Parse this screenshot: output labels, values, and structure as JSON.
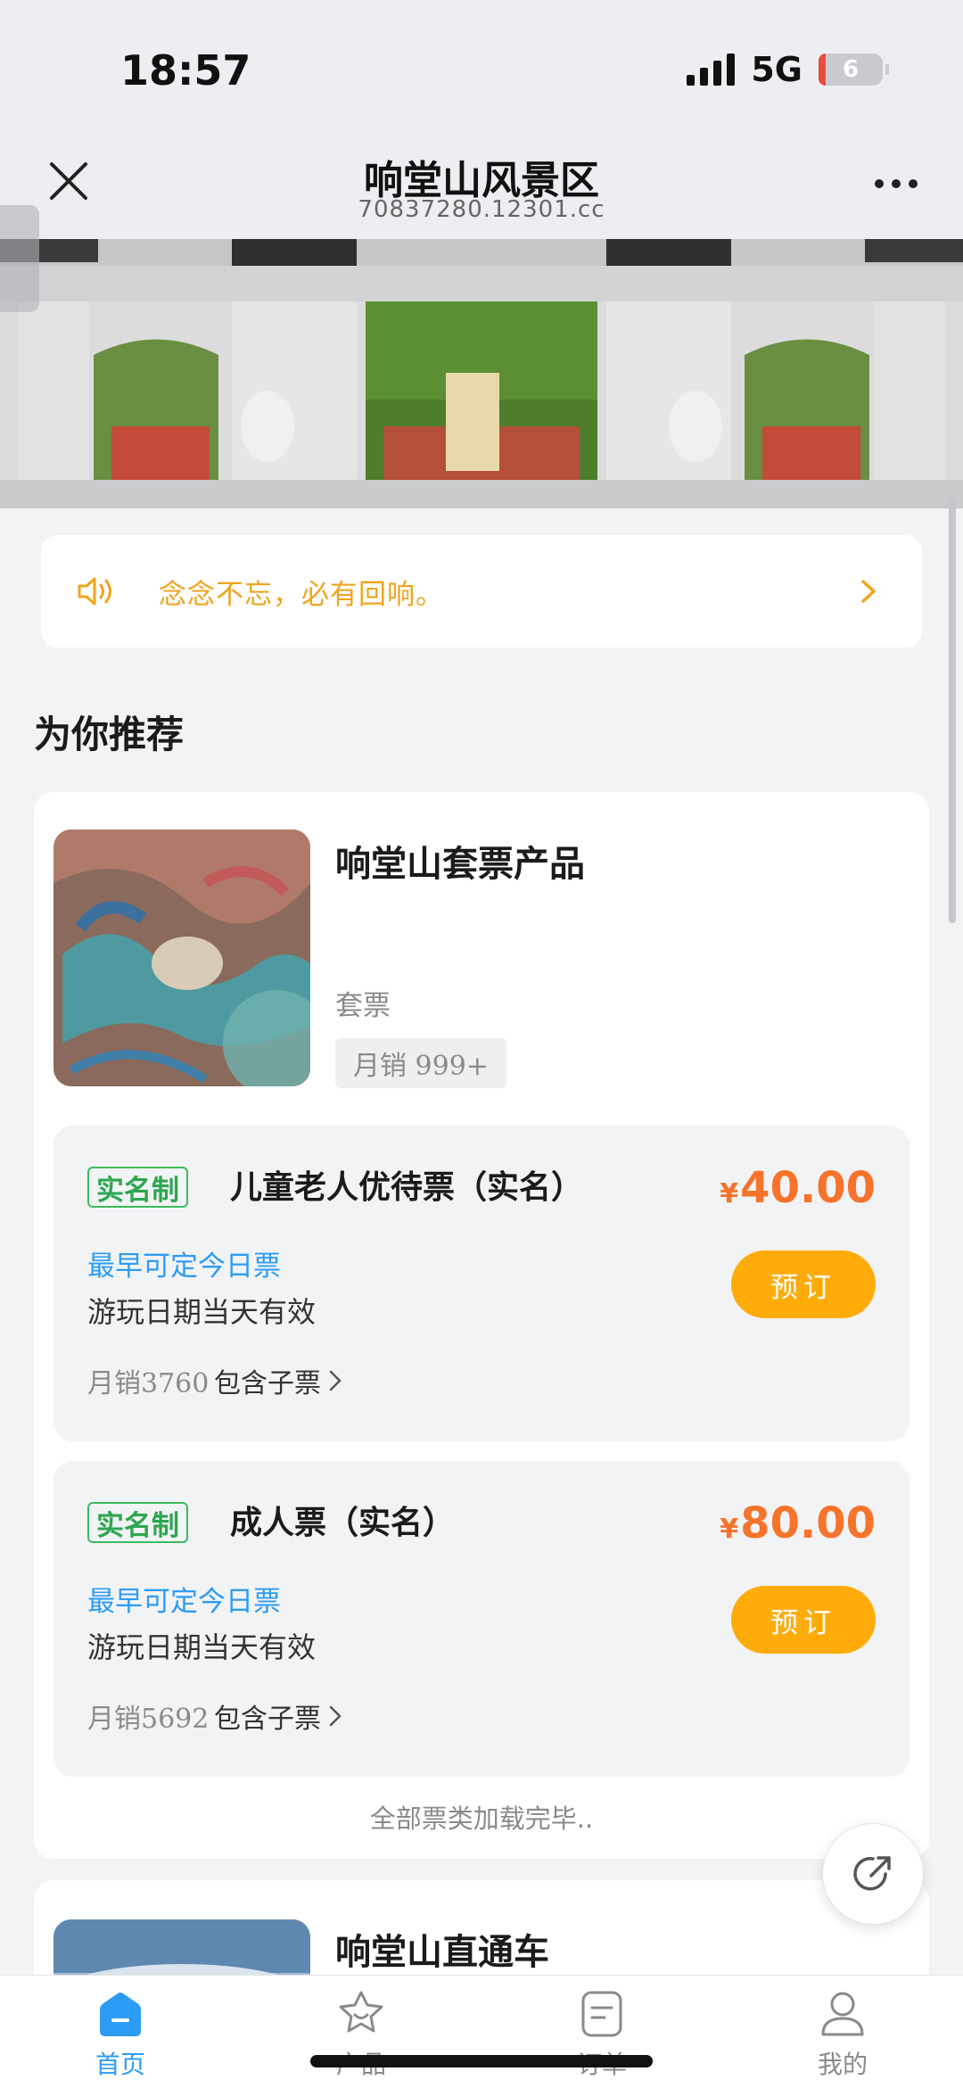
{
  "status_bar": {
    "time": "18:57",
    "network": "5G",
    "battery": "6"
  },
  "header": {
    "title": "响堂山风景区",
    "subtitle": "70837280.12301.cc"
  },
  "notice": {
    "text": "念念不忘，必有回响。"
  },
  "section": {
    "title": "为你推荐"
  },
  "product": {
    "name": "响堂山套票产品",
    "type": "套票",
    "monthly_sales": "月销 999+",
    "tickets": [
      {
        "badge": "实名制",
        "name": "儿童老人优待票（实名）",
        "currency": "¥",
        "price": "40.00",
        "earliest": "最早可定今日票",
        "validity": "游玩日期当天有效",
        "book_label": "预订",
        "sales": "月销3760",
        "sub_tickets": "包含子票"
      },
      {
        "badge": "实名制",
        "name": "成人票（实名）",
        "currency": "¥",
        "price": "80.00",
        "earliest": "最早可定今日票",
        "validity": "游玩日期当天有效",
        "book_label": "预订",
        "sales": "月销5692",
        "sub_tickets": "包含子票"
      }
    ],
    "load_done": "全部票类加载完毕.."
  },
  "product2": {
    "name": "响堂山直通车"
  },
  "tab_bar": {
    "items": [
      {
        "label": "首页",
        "icon": "home-icon",
        "active": true
      },
      {
        "label": "产品",
        "icon": "product-icon",
        "active": false
      },
      {
        "label": "订单",
        "icon": "order-icon",
        "active": false
      },
      {
        "label": "我的",
        "icon": "profile-icon",
        "active": false
      }
    ]
  },
  "colors": {
    "accent": "#2d9cf5",
    "price": "#f6732b",
    "button": "#ffab0a",
    "notice": "#f0a31c",
    "badge": "#2ea74f"
  }
}
